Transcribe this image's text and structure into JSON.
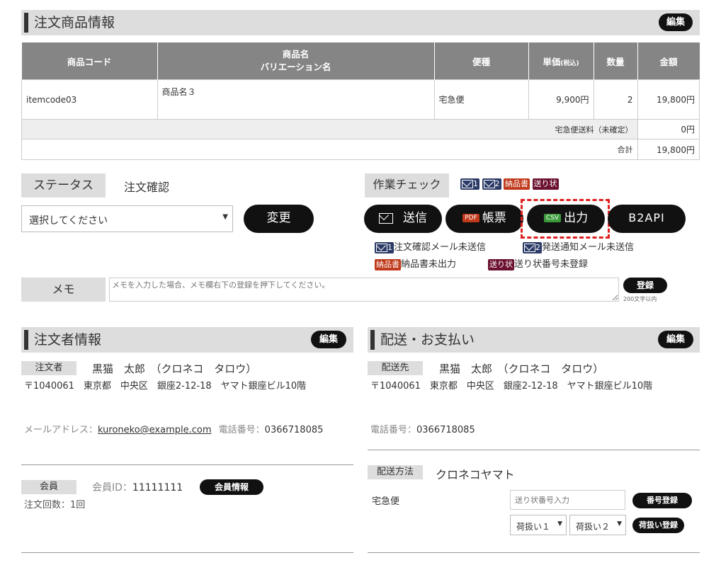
{
  "order_items": {
    "title": "注文商品情報",
    "edit": "編集",
    "headers": {
      "code": "商品コード",
      "name1": "商品名",
      "name2": "バリエーション名",
      "delivery": "便種",
      "price": "単価",
      "price_note": "(税込)",
      "qty": "数量",
      "amount": "金額"
    },
    "row": {
      "code": "itemcode03",
      "name": "商品名３",
      "delivery": "宅急便",
      "price": "9,900円",
      "qty": "2",
      "amount": "19,800円"
    },
    "shipping_label": "宅急便送料（未確定）",
    "shipping_value": "0円",
    "total_label": "合計",
    "total_value": "19,800円"
  },
  "status": {
    "label": "ステータス",
    "value": "注文確認",
    "select": "選択してください",
    "change": "変更"
  },
  "work": {
    "label": "作業チェック",
    "badge_mail1": "1",
    "badge_mail2": "2",
    "badge_invoice": "納品書",
    "badge_slip": "送り状",
    "send": "送信",
    "pdf": "PDF",
    "ledger": "帳票",
    "csv": "CSV",
    "output": "出力",
    "b2api": "B2API",
    "s1_num": "1",
    "s1_text": "注文確認メール未送信",
    "s2_num": "2",
    "s2_text": "発送通知メール未送信",
    "s3_badge": "納品書",
    "s3_text": "納品書未出力",
    "s4_badge": "送り状",
    "s4_text": "送り状番号未登録"
  },
  "memo": {
    "label": "メモ",
    "placeholder": "メモを入力した場合、メモ欄右下の登録を押下してください。",
    "register": "登録",
    "limit": "200文字以内"
  },
  "customer": {
    "title": "注文者情報",
    "edit": "編集",
    "tag": "注文者",
    "name": "黒猫　太郎　（クロネコ　タロウ）",
    "address": "〒1040061　東京都　中央区　銀座2-12-18　ヤマト銀座ビル10階",
    "email_label": "メールアドレス：",
    "email": "kuroneko@example.com",
    "phone_label": "電話番号：",
    "phone": "0366718085",
    "member_tag": "会員",
    "member_id_label": "会員ID：",
    "member_id": "11111111",
    "member_info": "会員情報",
    "order_count": "注文回数：1回"
  },
  "shipping": {
    "title": "配送・お支払い",
    "edit": "編集",
    "tag": "配送先",
    "name": "黒猫　太郎　（クロネコ　タロウ）",
    "address": "〒1040061　東京都　中央区　銀座2-12-18　ヤマト銀座ビル10階",
    "phone_label": "電話番号：",
    "phone": "0366718085",
    "method_tag": "配送方法",
    "method": "クロネコヤマト",
    "service": "宅急便",
    "tracking_placeholder": "送り状番号入力",
    "register_number": "番号登録",
    "handling1": "荷扱い１",
    "handling2": "荷扱い２",
    "register_handling": "荷扱い登録"
  },
  "colors": {
    "highlight": "#e02020",
    "dark": "#111111",
    "header_gray": "#858585"
  }
}
